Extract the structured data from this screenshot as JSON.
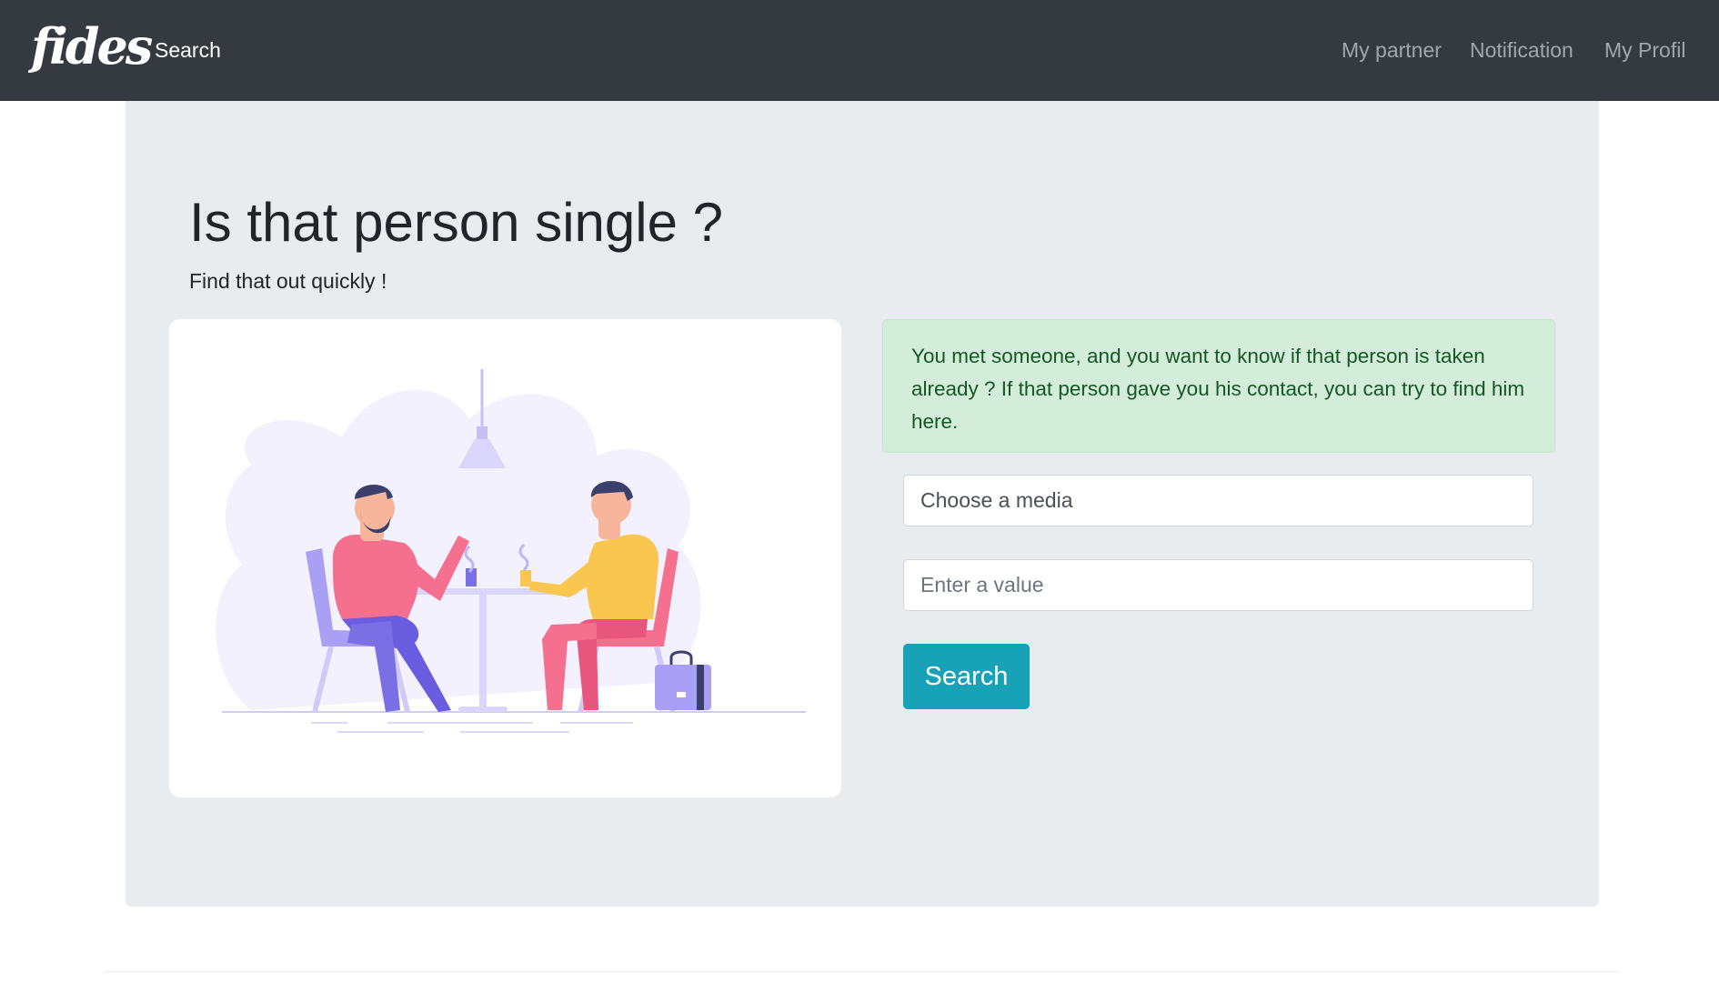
{
  "navbar": {
    "brand": "fides",
    "search_link": "Search",
    "links": [
      "My partner",
      "Notification",
      "My Profil"
    ]
  },
  "hero": {
    "title": "Is that person single ?",
    "subtitle": "Find that out quickly !"
  },
  "info_alert": "You met someone, and you want to know if that person is taken already ? If that person gave you his contact, you can try to find him here.",
  "form": {
    "media_placeholder": "Choose a media",
    "value_placeholder": "Enter a value",
    "submit_label": "Search"
  },
  "colors": {
    "navbar": "#343a40",
    "jumbotron": "#e9ecef",
    "alert_bg": "#d4edda",
    "alert_text": "#155724",
    "button": "#17a2b8",
    "illustration_purple": "#a99ff4",
    "illustration_pink": "#f5708e",
    "illustration_yellow": "#f9c74f"
  },
  "illustration": {
    "subject": "two-people-sitting-at-cafe-table"
  }
}
